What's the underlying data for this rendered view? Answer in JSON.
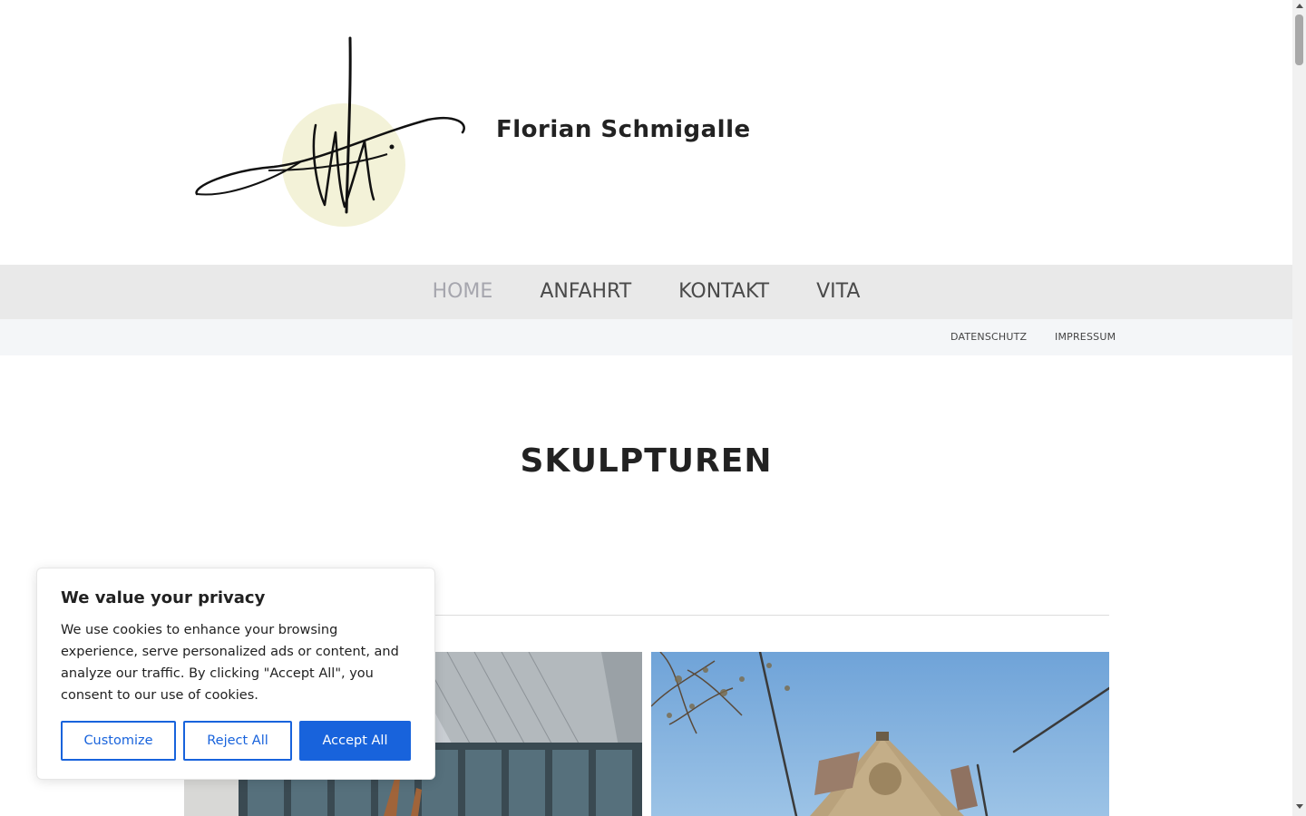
{
  "header": {
    "site_title": "Florian Schmigalle",
    "logo_icon": "signature-logo"
  },
  "main_nav": [
    {
      "label": "HOME",
      "active": true
    },
    {
      "label": "ANFAHRT",
      "active": false
    },
    {
      "label": "KONTAKT",
      "active": false
    },
    {
      "label": "VITA",
      "active": false
    }
  ],
  "sub_nav": {
    "datenschutz": "DATENSCHUTZ",
    "impressum": "IMPRESSUM"
  },
  "content": {
    "section_title": "SKULPTUREN"
  },
  "cookie_banner": {
    "title": "We value your privacy",
    "text": "We use cookies to enhance your browsing experience, serve personalized ads or content, and analyze our traffic. By clicking \"Accept All\", you consent to our use of cookies.",
    "customize_label": "Customize",
    "reject_label": "Reject All",
    "accept_label": "Accept All"
  },
  "colors": {
    "accent": "#1863dc",
    "nav_bg": "#e9e9e9",
    "nav_active": "#a6a6ae",
    "logo_circle": "#f3f2d8"
  }
}
